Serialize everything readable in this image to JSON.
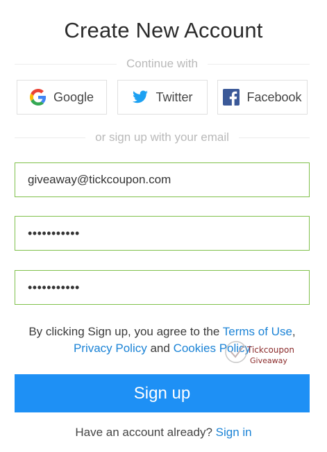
{
  "title": "Create New Account",
  "continue_with": "Continue with",
  "social": {
    "google": {
      "label": "Google",
      "icon": "google-icon"
    },
    "twitter": {
      "label": "Twitter",
      "icon": "twitter-icon"
    },
    "facebook": {
      "label": "Facebook",
      "icon": "facebook-icon"
    }
  },
  "or_email": "or sign up with your email",
  "fields": {
    "email_value": "giveaway@tickcoupon.com",
    "password_value": "•••••••••••",
    "confirm_value": "•••••••••••"
  },
  "terms": {
    "prefix": "By clicking Sign up, you agree to the ",
    "terms_link": "Terms of Use",
    "comma": ",",
    "privacy_link": "Privacy Policy",
    "and": " and ",
    "cookies_link": "Cookies Policy"
  },
  "watermark": {
    "line1": "Tickcoupon",
    "line2": "Giveaway"
  },
  "signup_button": "Sign up",
  "have_account": "Have an account already? ",
  "signin_link": "Sign in",
  "colors": {
    "primary": "#1e90f5",
    "link": "#1b83d6",
    "field_border": "#7fc04a",
    "twitter": "#1da1f2",
    "facebook": "#3b5998"
  }
}
